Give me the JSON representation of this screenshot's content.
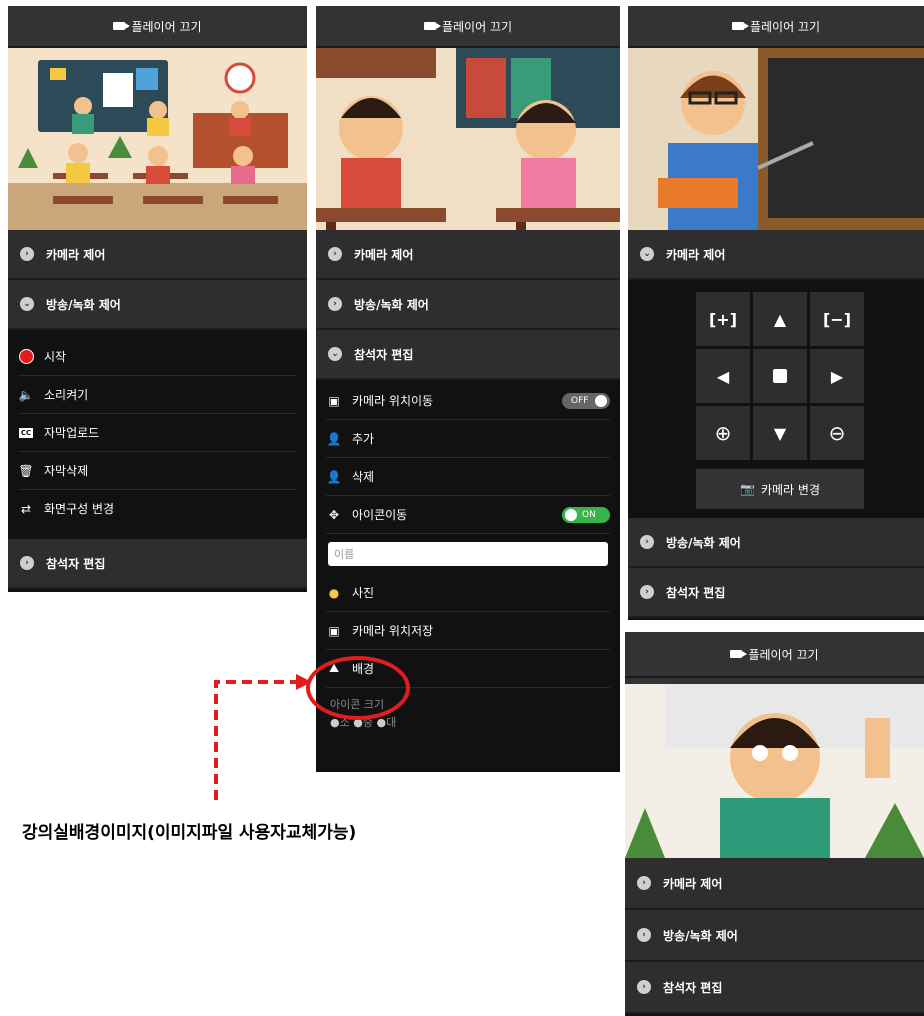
{
  "header": {
    "title": "플레이어 끄기"
  },
  "menu": {
    "camera_control": "카메라 제어",
    "broadcast_control": "방송/녹화 제어",
    "participant_edit": "참석자 편집"
  },
  "broadcast_items": [
    "시작",
    "소리켜기",
    "자막업로드",
    "자막삭제",
    "화면구성 변경"
  ],
  "participant_items": {
    "camera_move": "카메라 위치이동",
    "camera_move_toggle": "OFF",
    "add": "추가",
    "delete": "삭제",
    "icon_move": "아이콘이동",
    "icon_move_toggle": "ON",
    "name_placeholder": "이름",
    "photo": "사진",
    "camera_save": "카메라 위치저장",
    "background": "배경",
    "icon_size_label": "아이콘 크기",
    "sizes": [
      "소",
      "중",
      "대"
    ]
  },
  "camera_panel": {
    "change_button": "카메라 변경"
  },
  "annotation": "강의실배경이미지(이미지파일 사용자교체가능)",
  "colors": {
    "highlight": "#e21d1d",
    "toggle_on": "#38b44a",
    "panel": "#2e2e2e"
  }
}
